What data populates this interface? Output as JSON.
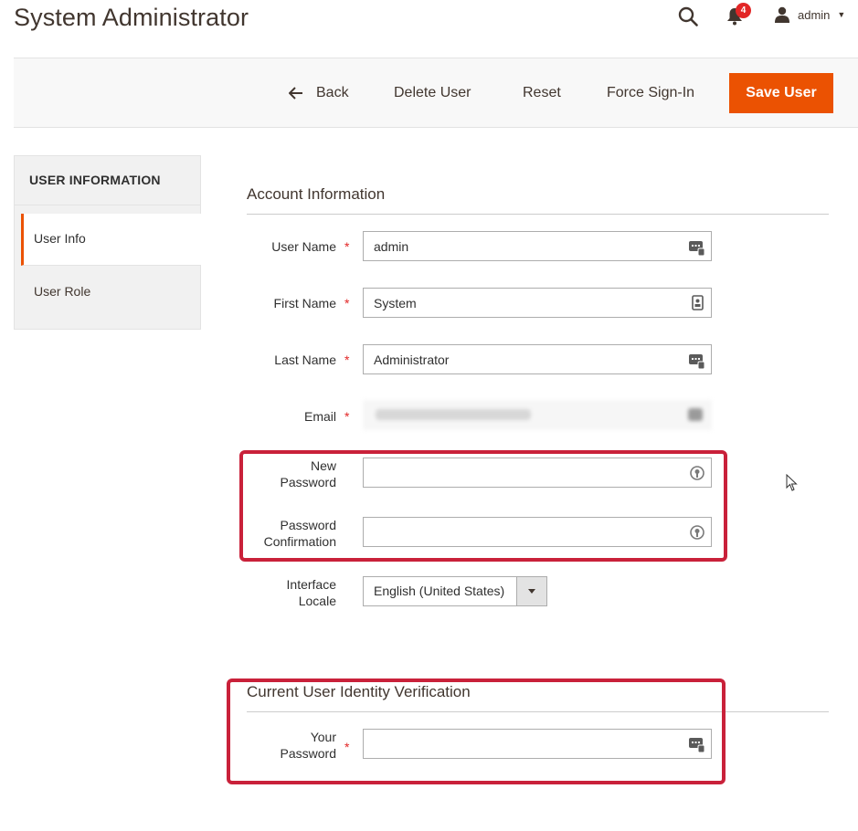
{
  "page": {
    "title": "System Administrator"
  },
  "header": {
    "notifications_count": "4",
    "user_label": "admin",
    "icons": [
      "search-icon",
      "bell-icon",
      "user-icon",
      "caret-down-icon"
    ]
  },
  "toolbar": {
    "back_label": "Back",
    "delete_label": "Delete User",
    "reset_label": "Reset",
    "force_signin_label": "Force Sign-In",
    "save_label": "Save User"
  },
  "sidebar": {
    "title": "USER INFORMATION",
    "items": [
      {
        "label": "User Info",
        "active": true
      },
      {
        "label": "User Role",
        "active": false
      }
    ]
  },
  "account": {
    "title": "Account Information",
    "fields": {
      "username": {
        "label": "User Name",
        "value": "admin"
      },
      "firstname": {
        "label": "First Name",
        "value": "System"
      },
      "lastname": {
        "label": "Last Name",
        "value": "Administrator"
      },
      "email": {
        "label": "Email",
        "value": ""
      },
      "new_password": {
        "label_line1": "New",
        "label_line2": "Password",
        "value": ""
      },
      "password_confirmation": {
        "label_line1": "Password",
        "label_line2": "Confirmation",
        "value": ""
      },
      "locale": {
        "label_line1": "Interface",
        "label_line2": "Locale",
        "value": "English (United States)"
      }
    }
  },
  "verification": {
    "title": "Current User Identity Verification",
    "password": {
      "label_line1": "Your",
      "label_line2": "Password",
      "value": ""
    }
  },
  "required_mark": "*",
  "colors": {
    "accent": "#eb5202",
    "highlight": "#c9213a",
    "required": "#e22626"
  }
}
